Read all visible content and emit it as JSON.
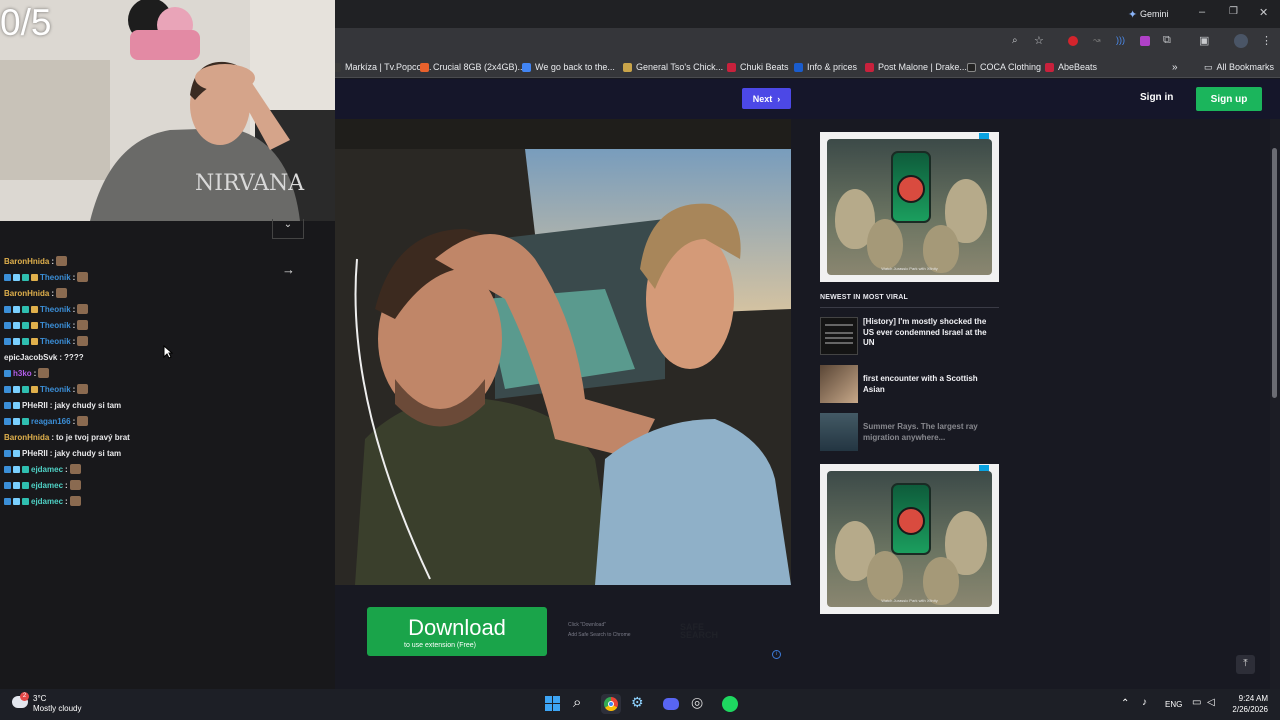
{
  "browser": {
    "gemini_label": "Gemini",
    "bookmarks": [
      {
        "label": "Markíza | Tv.Popcor...",
        "color": "#3a3a3a"
      },
      {
        "label": "Crucial 8GB (2x4GB)...",
        "color": "#e8612c"
      },
      {
        "label": "We go back to the...",
        "color": "#4285f4"
      },
      {
        "label": "General Tso's Chick...",
        "color": "#c9a44a"
      },
      {
        "label": "Chuki Beats",
        "color": "#c8213c"
      },
      {
        "label": "Info & prices",
        "color": "#1a5ccd"
      },
      {
        "label": "Post Malone | Drake...",
        "color": "#c8213c"
      },
      {
        "label": "COCA Clothing",
        "color": "#222222"
      },
      {
        "label": "AbeBeats",
        "color": "#c8213c"
      }
    ],
    "all_bookmarks_label": "All Bookmarks"
  },
  "site": {
    "next_label": "Next",
    "signin_label": "Sign in",
    "signup_label": "Sign up",
    "newest_title": "NEWEST IN MOST VIRAL",
    "viral_items": [
      {
        "title": "[History] I'm mostly shocked the US ever condemned Israel at the UN"
      },
      {
        "title": "first encounter with a Scottish Asian"
      },
      {
        "title": "Summer Rays. The largest ray migration anywhere..."
      }
    ],
    "ad_caption": "Watch Jurassic Park with Xfinity",
    "download_label": "Download",
    "download_sub": "to use extension (Free)",
    "safesearch_line1": "Click \"Download\"",
    "safesearch_line2": "Add Safe Search to Chrome",
    "safesearch_logo": "SAFE SEARCH"
  },
  "stream": {
    "counter": "0/5",
    "chat": [
      {
        "user": "BaronHnida",
        "color": "#e0b04c",
        "badges": 0,
        "msg": "",
        "emote": true
      },
      {
        "user": "Theonik",
        "color": "#3b8fd8",
        "badges": 4,
        "msg": "",
        "emote": true
      },
      {
        "user": "BaronHnida",
        "color": "#e0b04c",
        "badges": 0,
        "msg": "",
        "emote": true
      },
      {
        "user": "Theonik",
        "color": "#3b8fd8",
        "badges": 4,
        "msg": "",
        "emote": true
      },
      {
        "user": "Theonik",
        "color": "#3b8fd8",
        "badges": 4,
        "msg": "",
        "emote": true
      },
      {
        "user": "Theonik",
        "color": "#3b8fd8",
        "badges": 4,
        "msg": "",
        "emote": true
      },
      {
        "user": "epicJacobSvk",
        "color": "#e8e8ea",
        "badges": 0,
        "msg": "????",
        "emote": false
      },
      {
        "user": "h3ko",
        "color": "#b05ce8",
        "badges": 1,
        "msg": "",
        "emote": true
      },
      {
        "user": "Theonik",
        "color": "#3b8fd8",
        "badges": 4,
        "msg": "",
        "emote": true
      },
      {
        "user": "PHeRII",
        "color": "#e8e8ea",
        "badges": 2,
        "msg": "jaky chudy si tam",
        "emote": false
      },
      {
        "user": "reagan166",
        "color": "#3b8fd8",
        "badges": 3,
        "msg": "",
        "emote": true
      },
      {
        "user": "BaronHnida",
        "color": "#e0b04c",
        "badges": 0,
        "msg": "to je tvoj pravý brat",
        "emote": false
      },
      {
        "user": "PHeRII",
        "color": "#e8e8ea",
        "badges": 2,
        "msg": "jaky chudy si tam",
        "emote": false
      },
      {
        "user": "ejdamec",
        "color": "#4fd1c5",
        "badges": 3,
        "msg": "",
        "emote": true
      },
      {
        "user": "ejdamec",
        "color": "#4fd1c5",
        "badges": 3,
        "msg": "",
        "emote": true
      },
      {
        "user": "ejdamec",
        "color": "#4fd1c5",
        "badges": 3,
        "msg": "",
        "emote": true
      }
    ]
  },
  "taskbar": {
    "temp": "3°C",
    "weather": "Mostly cloudy",
    "weather_badge": "2",
    "lang": "ENG",
    "time": "9:24 AM",
    "date": "2/26/2026"
  }
}
